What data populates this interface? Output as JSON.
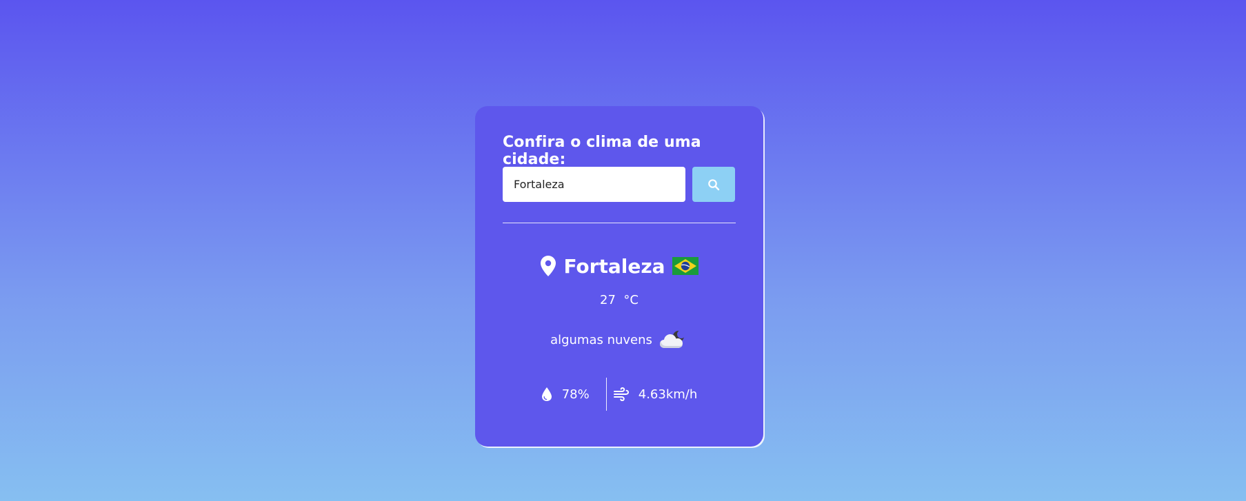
{
  "form": {
    "title": "Confira o clima de uma cidade:",
    "search_value": "Fortaleza",
    "search_icon": "search-icon"
  },
  "weather": {
    "city": "Fortaleza",
    "country_flag": "brazil-flag-icon",
    "temperature": "27",
    "unit": "°C",
    "description": "algumas nuvens",
    "description_icon": "cloud-partly-night-icon",
    "humidity": "78%",
    "wind": "4.63km/h"
  },
  "colors": {
    "card": "#5e57ec",
    "search_button": "#8dd0f4",
    "gradient_top": "#5b55ef",
    "gradient_bottom": "#86bff1"
  }
}
